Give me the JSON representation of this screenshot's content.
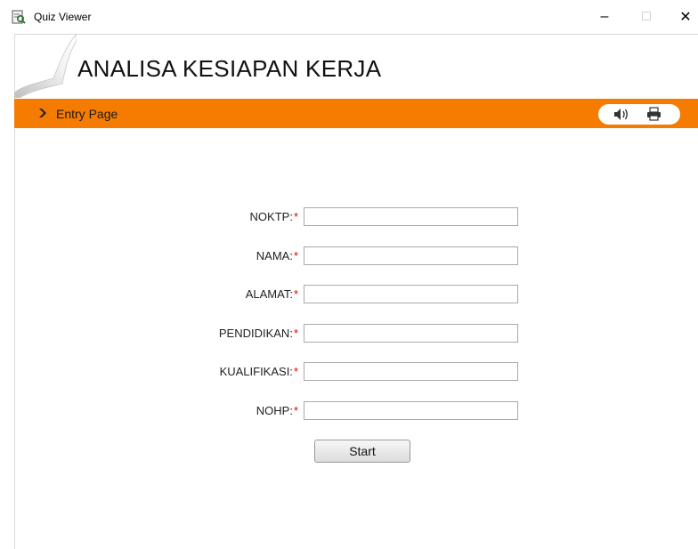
{
  "window": {
    "title": "Quiz Viewer",
    "minimize": "–",
    "maximize": "□",
    "close": "✕"
  },
  "page": {
    "title": "ANALISA KESIAPAN KERJA"
  },
  "navbar": {
    "label": "Entry Page",
    "icons": [
      "sound-icon",
      "print-icon"
    ]
  },
  "form": {
    "required_marker": "*",
    "fields": [
      {
        "label": "NOKTP:",
        "value": ""
      },
      {
        "label": "NAMA:",
        "value": ""
      },
      {
        "label": "ALAMAT:",
        "value": ""
      },
      {
        "label": "PENDIDIKAN:",
        "value": ""
      },
      {
        "label": "KUALIFIKASI:",
        "value": ""
      },
      {
        "label": "NOHP:",
        "value": ""
      }
    ],
    "submit_label": "Start"
  },
  "colors": {
    "accent": "#f57c00",
    "required": "#e00000"
  }
}
